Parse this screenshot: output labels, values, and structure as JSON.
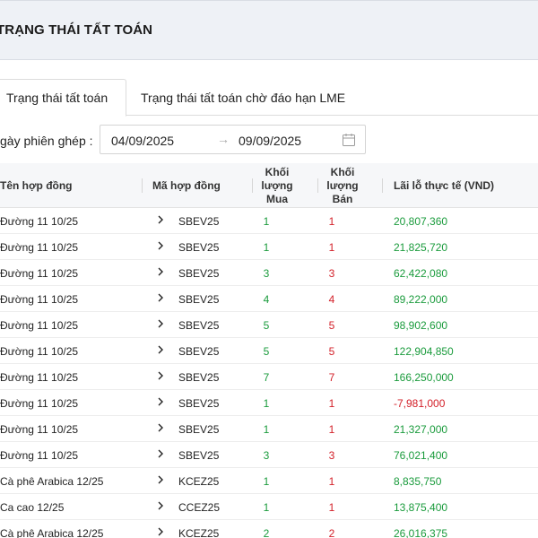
{
  "header": {
    "title": "TRẠNG THÁI TẤT TOÁN"
  },
  "tabs": [
    {
      "label": "Trạng thái tất toán",
      "active": true
    },
    {
      "label": "Trạng thái tất toán chờ đáo hạn LME",
      "active": false
    }
  ],
  "filter": {
    "label": "gày phiên ghép :",
    "start_date": "04/09/2025",
    "separator": "→",
    "end_date": "09/09/2025",
    "icon": "calendar-icon"
  },
  "table": {
    "columns": {
      "name": "Tên hợp đồng",
      "code": "Mã hợp đồng",
      "buy_line1": "Khối",
      "buy_line2": "lượng",
      "buy_line3": "Mua",
      "sell_line1": "Khối",
      "sell_line2": "lượng",
      "sell_line3": "Bán",
      "pnl": "Lãi lỗ thực tế (VND)"
    },
    "rows": [
      {
        "name": "Đường 11 10/25",
        "code": "SBEV25",
        "buy": "1",
        "sell": "1",
        "pnl": "20,807,360",
        "sign": "pos"
      },
      {
        "name": "Đường 11 10/25",
        "code": "SBEV25",
        "buy": "1",
        "sell": "1",
        "pnl": "21,825,720",
        "sign": "pos"
      },
      {
        "name": "Đường 11 10/25",
        "code": "SBEV25",
        "buy": "3",
        "sell": "3",
        "pnl": "62,422,080",
        "sign": "pos"
      },
      {
        "name": "Đường 11 10/25",
        "code": "SBEV25",
        "buy": "4",
        "sell": "4",
        "pnl": "89,222,000",
        "sign": "pos"
      },
      {
        "name": "Đường 11 10/25",
        "code": "SBEV25",
        "buy": "5",
        "sell": "5",
        "pnl": "98,902,600",
        "sign": "pos"
      },
      {
        "name": "Đường 11 10/25",
        "code": "SBEV25",
        "buy": "5",
        "sell": "5",
        "pnl": "122,904,850",
        "sign": "pos"
      },
      {
        "name": "Đường 11 10/25",
        "code": "SBEV25",
        "buy": "7",
        "sell": "7",
        "pnl": "166,250,000",
        "sign": "pos"
      },
      {
        "name": "Đường 11 10/25",
        "code": "SBEV25",
        "buy": "1",
        "sell": "1",
        "pnl": "-7,981,000",
        "sign": "neg"
      },
      {
        "name": "Đường 11 10/25",
        "code": "SBEV25",
        "buy": "1",
        "sell": "1",
        "pnl": "21,327,000",
        "sign": "pos"
      },
      {
        "name": "Đường 11 10/25",
        "code": "SBEV25",
        "buy": "3",
        "sell": "3",
        "pnl": "76,021,400",
        "sign": "pos"
      },
      {
        "name": "Cà phê Arabica 12/25",
        "code": "KCEZ25",
        "buy": "1",
        "sell": "1",
        "pnl": "8,835,750",
        "sign": "pos"
      },
      {
        "name": "Ca cao 12/25",
        "code": "CCEZ25",
        "buy": "1",
        "sell": "1",
        "pnl": "13,875,400",
        "sign": "pos"
      },
      {
        "name": "Cà phê Arabica 12/25",
        "code": "KCEZ25",
        "buy": "2",
        "sell": "2",
        "pnl": "26,016,375",
        "sign": "pos"
      }
    ]
  },
  "colors": {
    "positive": "#1a9b3c",
    "negative": "#d32029",
    "header_bg": "#eef1f6"
  },
  "icons": {
    "row_expand": "chevron-right-icon"
  }
}
